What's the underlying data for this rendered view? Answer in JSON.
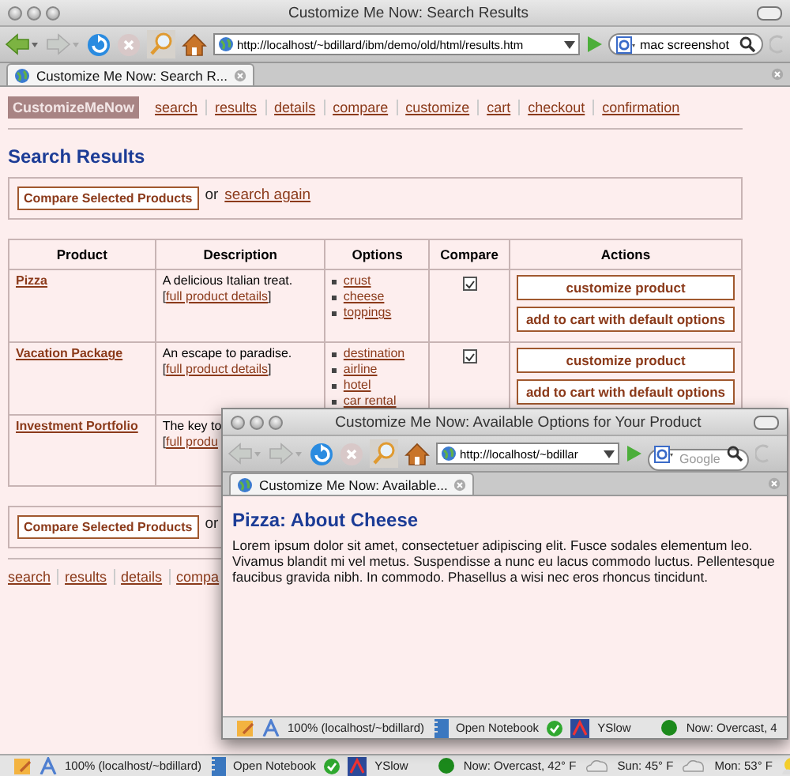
{
  "window": {
    "title": "Customize Me Now: Search Results"
  },
  "toolbar": {
    "url": "http://localhost/~bdillard/ibm/demo/old/html/results.htm",
    "search_value": "mac screenshot"
  },
  "tabs": [
    {
      "label": "Customize Me Now: Search R...",
      "selected": true
    }
  ],
  "page": {
    "brand": "CustomizeMeNow",
    "nav": [
      "search",
      "results",
      "details",
      "compare",
      "customize",
      "cart",
      "checkout",
      "confirmation"
    ],
    "heading": "Search Results",
    "top_bar": {
      "button": "Compare Selected Products",
      "or_text": "or",
      "link": "search again"
    },
    "table": {
      "columns": [
        "Product",
        "Description",
        "Options",
        "Compare",
        "Actions"
      ],
      "rows": [
        {
          "product": "Pizza",
          "description": "A delicious Italian treat.",
          "details": {
            "open": "[",
            "link": "full product details",
            "close": "]"
          },
          "options": [
            "crust",
            "cheese",
            "toppings"
          ],
          "compare": true,
          "actions": [
            "customize product",
            "add to cart with default options"
          ]
        },
        {
          "product": "Vacation Package",
          "description": "An escape to paradise.",
          "details": {
            "open": "[",
            "link": "full product details",
            "close": "]"
          },
          "options": [
            "destination",
            "airline",
            "hotel",
            "car rental"
          ],
          "compare": true,
          "actions": [
            "customize product",
            "add to cart with default options"
          ]
        },
        {
          "product": "Investment Portfolio",
          "description": "The key to",
          "details": {
            "open": "[",
            "link": "full produ"
          }
        }
      ]
    },
    "bottom_bar": {
      "button": "Compare Selected Products",
      "or_text": "or"
    },
    "bottom_nav": [
      "search",
      "results",
      "details",
      "compa"
    ]
  },
  "status_bar": {
    "zoom": "100% (localhost/~bdillard)",
    "notebook": "Open Notebook",
    "yslow": "YSlow",
    "weather": [
      "Now: Overcast, 42° F",
      "Sun: 45° F",
      "Mon: 53° F"
    ]
  },
  "popup": {
    "title": "Customize Me Now: Available Options for Your Product",
    "url": "http://localhost/~bdillar",
    "search_placeholder": "Google",
    "tabs": [
      {
        "label": "Customize Me Now: Available...",
        "selected": true
      }
    ],
    "heading": "Pizza: About Cheese",
    "paragraph": "Lorem ipsum dolor sit amet, consectetuer adipiscing elit. Fusce sodales elementum leo. Vivamus blandit mi vel metus. Suspendisse a nunc eu lacus commodo luctus. Pellentesque faucibus gravida nibh. In commodo. Phasellus a wisi nec eros rhoncus tincidunt.",
    "status_bar": {
      "zoom": "100% (localhost/~bdillard)",
      "notebook": "Open Notebook",
      "yslow": "YSlow",
      "weather": [
        "Now: Overcast, 4"
      ]
    }
  }
}
